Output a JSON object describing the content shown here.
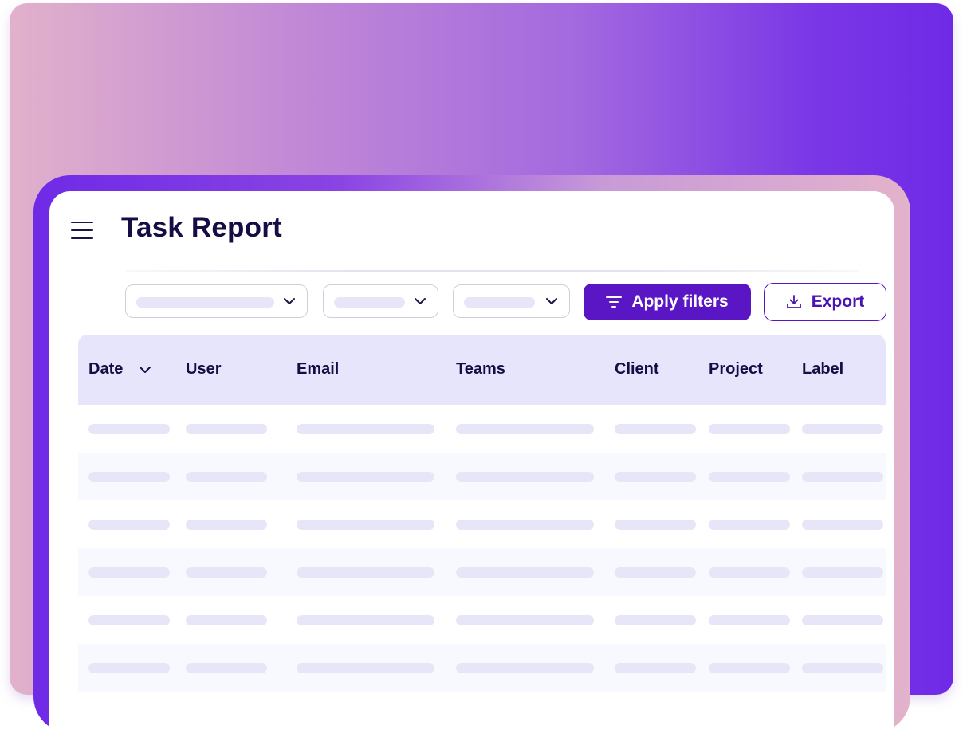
{
  "header": {
    "title": "Task Report"
  },
  "filters": {
    "dropdowns": [
      {
        "name": "filter-dropdown-1",
        "icon": "chevron-down-icon"
      },
      {
        "name": "filter-dropdown-2",
        "icon": "chevron-down-icon"
      },
      {
        "name": "filter-dropdown-3",
        "icon": "chevron-down-icon"
      }
    ],
    "apply_label": "Apply filters",
    "apply_icon": "filter-icon",
    "export_label": "Export",
    "export_icon": "download-icon"
  },
  "table": {
    "columns": [
      "Date",
      "User",
      "Email",
      "Teams",
      "Client",
      "Project",
      "Label"
    ],
    "sort_icon": "chevron-down-icon",
    "row_count": 6
  },
  "colors": {
    "accent": "#5a16c4",
    "title": "#150d44",
    "header_bg": "#e6e5fb",
    "placeholder": "#e6e6f8"
  }
}
